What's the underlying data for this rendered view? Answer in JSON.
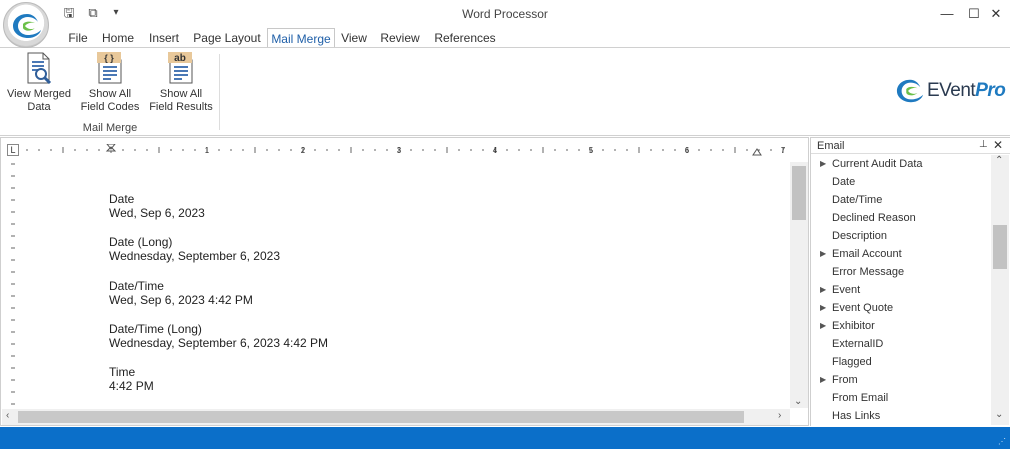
{
  "window": {
    "title": "Word Processor"
  },
  "quick_access": [
    {
      "name": "save-icon",
      "glyph": "🖫"
    },
    {
      "name": "save-all-icon",
      "glyph": "⧉"
    },
    {
      "name": "customize-dropdown-icon",
      "glyph": "▾"
    }
  ],
  "window_controls": {
    "minimize": "—",
    "maximize": "☐",
    "close": "✕"
  },
  "tabs": [
    "File",
    "Home",
    "Insert",
    "Page Layout",
    "Mail Merge",
    "View",
    "Review",
    "References"
  ],
  "active_tab": "Mail Merge",
  "ribbon": {
    "view_merged": "View Merged\nData",
    "show_codes": "Show All\nField Codes",
    "show_results": "Show All\nField Results",
    "group_label": "Mail Merge",
    "show_codes_badge": "{ }",
    "show_results_badge": "ab"
  },
  "brand": {
    "part1": "EVent",
    "part2": "Pro"
  },
  "document": {
    "fields": [
      {
        "label": "Date",
        "value": "Wed, Sep 6, 2023"
      },
      {
        "label": "Date (Long)",
        "value": "Wednesday, September 6, 2023"
      },
      {
        "label": "Date/Time",
        "value": "Wed, Sep 6, 2023 4:42 PM"
      },
      {
        "label": "Date/Time (Long)",
        "value": "Wednesday, September 6, 2023 4:42 PM"
      },
      {
        "label": "Time",
        "value": "4:42 PM"
      }
    ],
    "ruler_corner": "L",
    "ruler_numbers": [
      "1",
      "2",
      "3",
      "4",
      "5",
      "6",
      "7"
    ]
  },
  "panel": {
    "title": "Email",
    "pin": "📌",
    "close": "✕",
    "items": [
      {
        "label": "Current Audit Data",
        "expandable": true
      },
      {
        "label": "Date",
        "expandable": false
      },
      {
        "label": "Date/Time",
        "expandable": false
      },
      {
        "label": "Declined Reason",
        "expandable": false
      },
      {
        "label": "Description",
        "expandable": false
      },
      {
        "label": "Email Account",
        "expandable": true
      },
      {
        "label": "Error Message",
        "expandable": false
      },
      {
        "label": "Event",
        "expandable": true
      },
      {
        "label": "Event Quote",
        "expandable": true
      },
      {
        "label": "Exhibitor",
        "expandable": true
      },
      {
        "label": "ExternalID",
        "expandable": false
      },
      {
        "label": "Flagged",
        "expandable": false
      },
      {
        "label": "From",
        "expandable": true
      },
      {
        "label": "From Email",
        "expandable": false
      },
      {
        "label": "Has Links",
        "expandable": false
      }
    ]
  },
  "colors": {
    "accent": "#0b6fc9",
    "tab_active": "#1f5fa8",
    "brand_blue": "#1f7ac0",
    "brand_green": "#6cc04a"
  }
}
